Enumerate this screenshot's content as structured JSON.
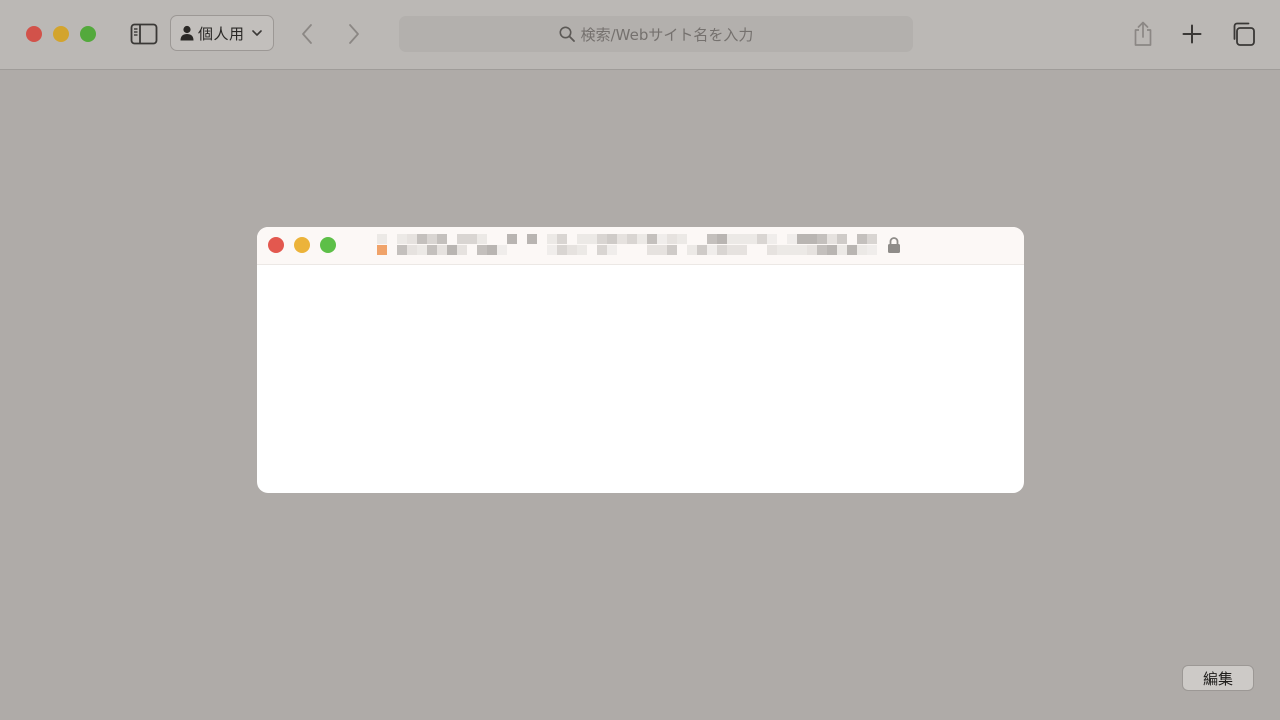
{
  "window": {
    "traffic_lights": [
      "close",
      "minimize",
      "zoom"
    ]
  },
  "toolbar": {
    "profile_label": "個人用",
    "search_placeholder": "検索/Webサイト名を入力"
  },
  "colors": {
    "desktop_bg": "#afaba8",
    "toolbar_bg": "#bbb8b5",
    "close": "#d2524a",
    "minimize": "#d3a42d",
    "zoom": "#53a93c",
    "thumbnail_bar": "#fcf8f6",
    "thumbnail_body": "#ffffff"
  },
  "thumbnail": {
    "title": "",
    "secure": true
  },
  "footer": {
    "edit_label": "編集"
  }
}
